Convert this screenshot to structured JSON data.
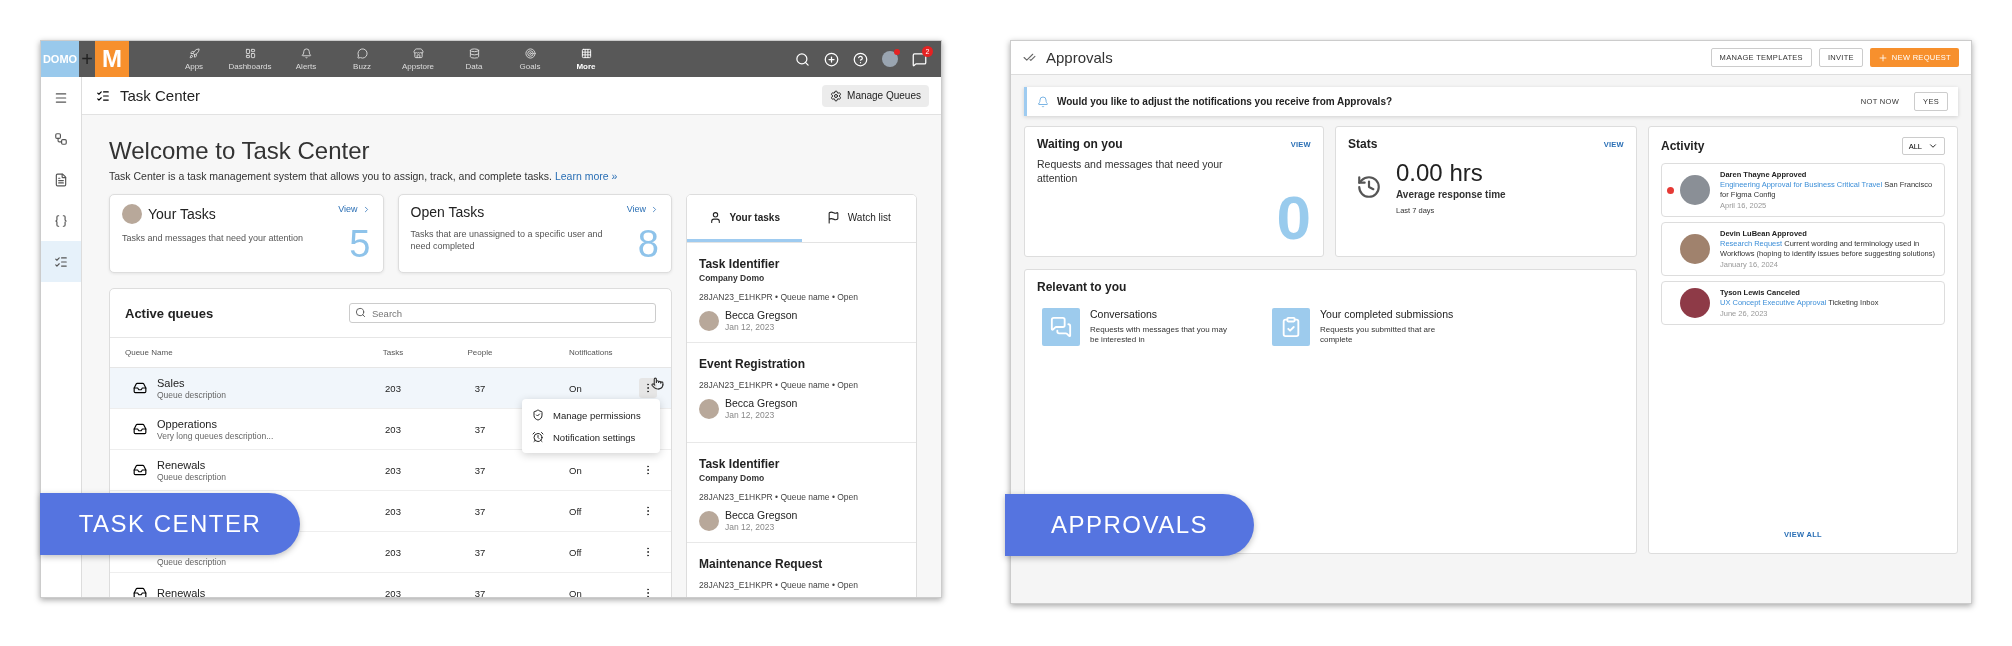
{
  "task_center": {
    "top_nav": {
      "logo": "DOMO",
      "plus": "+",
      "brand": "M",
      "items": [
        {
          "label": "Apps",
          "selected": false
        },
        {
          "label": "Dashboards",
          "selected": false
        },
        {
          "label": "Alerts",
          "selected": false
        },
        {
          "label": "Buzz",
          "selected": false
        },
        {
          "label": "Appstore",
          "selected": false
        },
        {
          "label": "Data",
          "selected": false
        },
        {
          "label": "Goals",
          "selected": false
        },
        {
          "label": "More",
          "selected": true
        }
      ],
      "chat_badge": "2"
    },
    "sidebar": [
      {
        "selected": false
      },
      {
        "selected": false
      },
      {
        "selected": false
      },
      {
        "selected": false
      },
      {
        "selected": true
      }
    ],
    "header": {
      "title": "Task Center",
      "button": "Manage Queues"
    },
    "welcome": {
      "title": "Welcome to Task Center",
      "description": "Task Center is a task management system that allows you to assign, track, and complete tasks.",
      "link": "Learn more »"
    },
    "summary_cards": [
      {
        "title": "Your Tasks",
        "link": "View",
        "description": "Tasks and messages that need your attention",
        "count": "5",
        "avatar": true
      },
      {
        "title": "Open Tasks",
        "link": "View",
        "description": "Tasks that are unassigned to a specific user and need completed",
        "count": "8",
        "avatar": false
      }
    ],
    "queues": {
      "title": "Active queues",
      "search": {
        "placeholder": "Search"
      },
      "columns": [
        "Queue Name",
        "Tasks",
        "People",
        "Notifications"
      ],
      "rows": [
        {
          "name": "Sales",
          "description": "Queue description",
          "tasks": "203",
          "people": "37",
          "notifications": "On",
          "highlighted": true
        },
        {
          "name": "Opperations",
          "description": "Very long queues description...",
          "tasks": "203",
          "people": "37",
          "highlighted": false
        },
        {
          "name": "Renewals",
          "description": "Queue description",
          "tasks": "203",
          "people": "37",
          "notifications": "On",
          "highlighted": false
        },
        {
          "tasks": "203",
          "people": "37",
          "notifications": "Off"
        },
        {
          "description": "Queue description",
          "tasks": "203",
          "people": "37",
          "notifications": "Off"
        },
        {
          "name": "Renewals",
          "tasks": "203",
          "people": "37",
          "notifications": "On",
          "highlighted": false
        }
      ],
      "menu": [
        "Manage permissions",
        "Notification settings"
      ]
    },
    "task_panel": {
      "tabs": [
        {
          "label": "Your tasks",
          "selected": true
        },
        {
          "label": "Watch list",
          "selected": false
        }
      ],
      "tasks": [
        {
          "title": "Task Identifier",
          "company": "Company Domo",
          "meta": "28JAN23_E1HKPR • Queue name • Open",
          "assignee": "Becca Gregson",
          "date": "Jan 12, 2023"
        },
        {
          "title": "Event Registration",
          "meta": "28JAN23_E1HKPR • Queue name • Open",
          "assignee": "Becca Gregson",
          "date": "Jan 12, 2023"
        },
        {
          "title": "Task Identifier",
          "company": "Company Domo",
          "meta": "28JAN23_E1HKPR • Queue name • Open",
          "assignee": "Becca Gregson",
          "date": "Jan 12, 2023"
        },
        {
          "title": "Maintenance Request",
          "meta": "28JAN23_E1HKPR • Queue name • Open"
        }
      ]
    },
    "badge": "TASK CENTER"
  },
  "approvals": {
    "header": {
      "title": "Approvals",
      "buttons": [
        {
          "label": "MANAGE TEMPLATES",
          "kind": "outline"
        },
        {
          "label": "INVITE",
          "kind": "outline"
        },
        {
          "label": "NEW REQUEST",
          "kind": "primary"
        }
      ]
    },
    "banner": {
      "text": "Would you like to adjust the notifications you receive from Approvals?",
      "buttons": [
        {
          "label": "NOT NOW",
          "kind": "text"
        },
        {
          "label": "YES",
          "kind": "outline"
        }
      ]
    },
    "waiting": {
      "title": "Waiting on you",
      "link": "VIEW",
      "description": "Requests and messages that need your attention",
      "count": "0"
    },
    "stats": {
      "title": "Stats",
      "link": "VIEW",
      "value": "0.00 hrs",
      "label": "Average response time",
      "period": "Last 7 days"
    },
    "relevant": {
      "title": "Relevant to you",
      "items": [
        {
          "kind": "conversations",
          "title": "Conversations",
          "description": "Requests with messages that you may be interested in"
        },
        {
          "kind": "submissions",
          "title": "Your completed submissions",
          "description": "Requests you submitted that are complete"
        }
      ]
    },
    "activity": {
      "title": "Activity",
      "filter": "ALL",
      "items": [
        {
          "heading": "Daren Thayne Approved",
          "link": "Engineering Approval for Business Critical Travel",
          "text": "San Francisco for Figma Config",
          "date": "April 16, 2025",
          "unread": true
        },
        {
          "heading": "Devin LuBean Approved",
          "link": "Research Request",
          "text": "Current wording and terminology used in Workflows (hoping to identify issues before suggesting solutions)",
          "date": "January 16, 2024",
          "unread": false
        },
        {
          "heading": "Tyson Lewis Canceled",
          "link": "UX Concept Executive Approval",
          "text": "Ticketing Inbox",
          "date": "June 26, 2023",
          "unread": false
        }
      ],
      "view_all": "VIEW ALL"
    },
    "badge": "APPROVALS"
  }
}
